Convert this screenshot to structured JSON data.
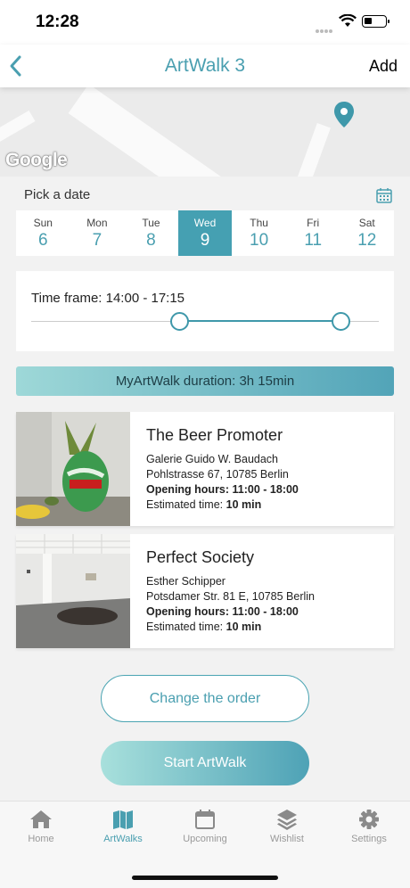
{
  "status": {
    "time": "12:28"
  },
  "nav": {
    "title": "ArtWalk 3",
    "add_label": "Add"
  },
  "map": {
    "logo_text": "Google"
  },
  "date_picker": {
    "label": "Pick a date",
    "days": [
      {
        "name": "Sun",
        "num": "6"
      },
      {
        "name": "Mon",
        "num": "7"
      },
      {
        "name": "Tue",
        "num": "8"
      },
      {
        "name": "Wed",
        "num": "9",
        "selected": true
      },
      {
        "name": "Thu",
        "num": "10"
      },
      {
        "name": "Fri",
        "num": "11"
      },
      {
        "name": "Sat",
        "num": "12"
      }
    ]
  },
  "timeframe": {
    "label": "Time frame: 14:00 - 17:15"
  },
  "duration": {
    "label": "MyArtWalk duration: 3h 15min"
  },
  "artworks": [
    {
      "title": "The Beer Promoter",
      "gallery": "Galerie Guido W. Baudach",
      "address": "Pohlstrasse 67, 10785 Berlin",
      "hours_label": "Opening hours: 11:00 - 18:00",
      "est_prefix": "Estimated time: ",
      "est_value": "10 min"
    },
    {
      "title": "Perfect Society",
      "gallery": "Esther Schipper",
      "address": "Potsdamer Str. 81 E, 10785 Berlin",
      "hours_label": "Opening hours: 11:00 - 18:00",
      "est_prefix": "Estimated time: ",
      "est_value": "10 min"
    }
  ],
  "actions": {
    "change_order": "Change the order",
    "start": "Start ArtWalk"
  },
  "tabs": [
    {
      "label": "Home",
      "icon": "home-icon"
    },
    {
      "label": "ArtWalks",
      "icon": "map-icon",
      "active": true
    },
    {
      "label": "Upcoming",
      "icon": "calendar-icon"
    },
    {
      "label": "Wishlist",
      "icon": "layers-icon"
    },
    {
      "label": "Settings",
      "icon": "gear-icon"
    }
  ],
  "colors": {
    "accent": "#4a9fb0",
    "selected_day": "#45a0b2"
  }
}
